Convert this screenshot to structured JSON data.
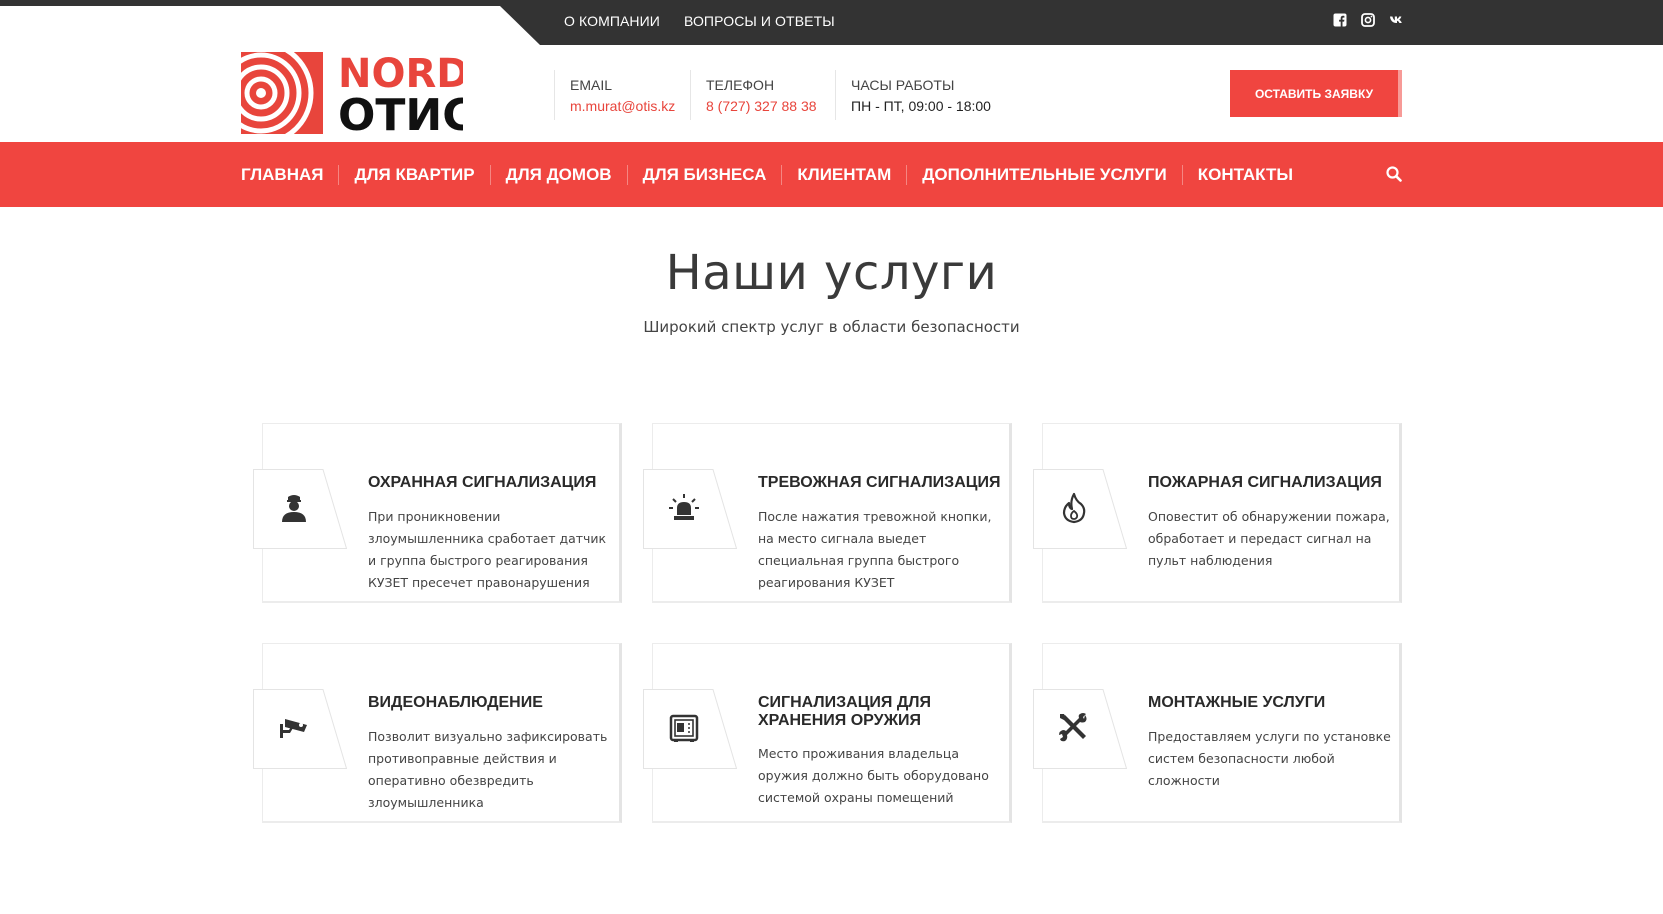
{
  "topbar": {
    "links": [
      "О КОМПАНИИ",
      "ВОПРОСЫ И ОТВЕТЫ"
    ],
    "social": [
      "facebook-icon",
      "instagram-icon",
      "vk-icon"
    ]
  },
  "logo": {
    "line1": "NORD",
    "line2": "ОТИС"
  },
  "contacts": {
    "email_label": "EMAIL",
    "email": "m.murat@otis.kz",
    "phone_label": "ТЕЛЕФОН",
    "phone": "8 (727) 327 88 38",
    "hours_label": "ЧАСЫ РАБОТЫ",
    "hours": "ПН - ПТ, 09:00 - 18:00"
  },
  "cta_label": "ОСТАВИТЬ ЗАЯВКУ",
  "nav": [
    "ГЛАВНАЯ",
    "ДЛЯ КВАРТИР",
    "ДЛЯ ДОМОВ",
    "ДЛЯ БИЗНЕСА",
    "КЛИЕНТАМ",
    "ДОПОЛНИТЕЛЬНЫЕ УСЛУГИ",
    "КОНТАКТЫ"
  ],
  "section": {
    "title": "Наши услуги",
    "subtitle": "Широкий спектр услуг в области безопасности"
  },
  "services": [
    {
      "icon": "guard-icon",
      "title": "ОХРАННАЯ СИГНАЛИЗАЦИЯ",
      "text": "При проникновении злоумышленника сработает датчик и группа быстрого реагирования КУЗЕТ пресечет правонарушения"
    },
    {
      "icon": "siren-icon",
      "title": "ТРЕВОЖНАЯ СИГНАЛИЗАЦИЯ",
      "text": "После нажатия тревожной кнопки, на место сигнала выедет специальная группа быстрого реагирования КУЗЕТ"
    },
    {
      "icon": "fire-icon",
      "title": "ПОЖАРНАЯ СИГНАЛИЗАЦИЯ",
      "text": "Оповестит об обнаружении пожара, обработает и передаст сигнал на пульт наблюдения"
    },
    {
      "icon": "camera-icon",
      "title": "ВИДЕОНАБЛЮДЕНИЕ",
      "text": "Позволит визуально зафиксировать противоправные действия и оперативно обезвредить злоумышленника"
    },
    {
      "icon": "safe-icon",
      "title": "СИГНАЛИЗАЦИЯ ДЛЯ ХРАНЕНИЯ ОРУЖИЯ",
      "text": "Место проживания владельца оружия должно быть оборудовано системой охраны помещений"
    },
    {
      "icon": "tools-icon",
      "title": "МОНТАЖНЫЕ УСЛУГИ",
      "text": "Предоставляем услуги по установке систем безопасности любой сложности"
    }
  ],
  "colors": {
    "accent": "#f04540",
    "dark": "#333333"
  }
}
